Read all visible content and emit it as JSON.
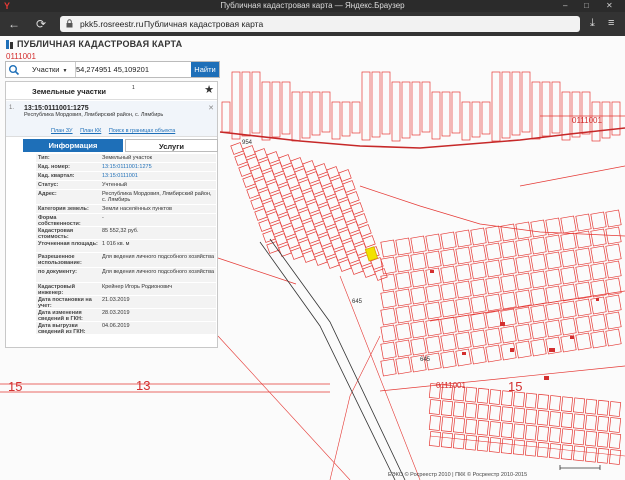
{
  "browser": {
    "window_title": "Публичная кадастровая карта — Яндекс.Браузер",
    "domain": "pkk5.rosreestr.ru",
    "page_title": "Публичная кадастровая карта",
    "logo": "Y"
  },
  "app": {
    "title": "ПУБЛИЧНАЯ КАДАСТРОВАЯ КАРТА"
  },
  "search": {
    "type_label": "Участки",
    "query": "54,274951 45,109201",
    "button": "Найти"
  },
  "panel": {
    "title": "Земельные участки",
    "count": "1",
    "record": {
      "index": "1.",
      "cad_number": "13:15:0111001:1275",
      "address": "Республика Мордовия, Лямбирский район, с. Лямбирь",
      "links": [
        "План ЗУ",
        "План КК",
        "Поиск в границах объекта"
      ]
    },
    "tabs": [
      "Информация",
      "Услуги"
    ],
    "info": [
      {
        "k": "Тип:",
        "v": "Земельный участок"
      },
      {
        "k": "Кад. номер:",
        "v": "13:15:0111001:1275",
        "link": true
      },
      {
        "k": "Кад. квартал:",
        "v": "13:15:0111001",
        "link": true
      },
      {
        "k": "Статус:",
        "v": "Учтенный"
      },
      {
        "k": "Адрес:",
        "v": "Республика Мордовия, Лямбирский район, с. Лямбирь"
      },
      {
        "k": "Категория земель:",
        "v": "Земли населённых пунктов"
      },
      {
        "k": "Форма собственности:",
        "v": "-"
      },
      {
        "k": "Кадастровая стоимость:",
        "v": "85 552,32 руб."
      },
      {
        "k": "Уточненная площадь:",
        "v": "1 016 кв. м"
      },
      {
        "k": "Разрешенное использование:",
        "v": "Для ведения личного подсобного хозяйства"
      },
      {
        "k": "по документу:",
        "v": "Для ведения личного подсобного хозяйства"
      },
      {
        "k": "Кадастровый инженер:",
        "v": "Крейнер Игорь Родионович"
      },
      {
        "k": "Дата постановки на учет:",
        "v": "21.03.2019"
      },
      {
        "k": "Дата изменения сведений в ГКН:",
        "v": "28.03.2019"
      },
      {
        "k": "Дата выгрузки сведений из ГКН:",
        "v": "04.06.2019"
      }
    ]
  },
  "map": {
    "labels": {
      "quarter_top_left": "0111001",
      "quarter_right": "0111001",
      "quarter_bottom": "0111001",
      "num_15_left": "15",
      "num_13": "13",
      "num_15_right": "15",
      "num_645_a": "645",
      "num_645_b": "645",
      "num_954": "954"
    },
    "copyright": "ЕЭКО © Росреестр 2010 | ПКК © Росреестр 2010-2015"
  }
}
